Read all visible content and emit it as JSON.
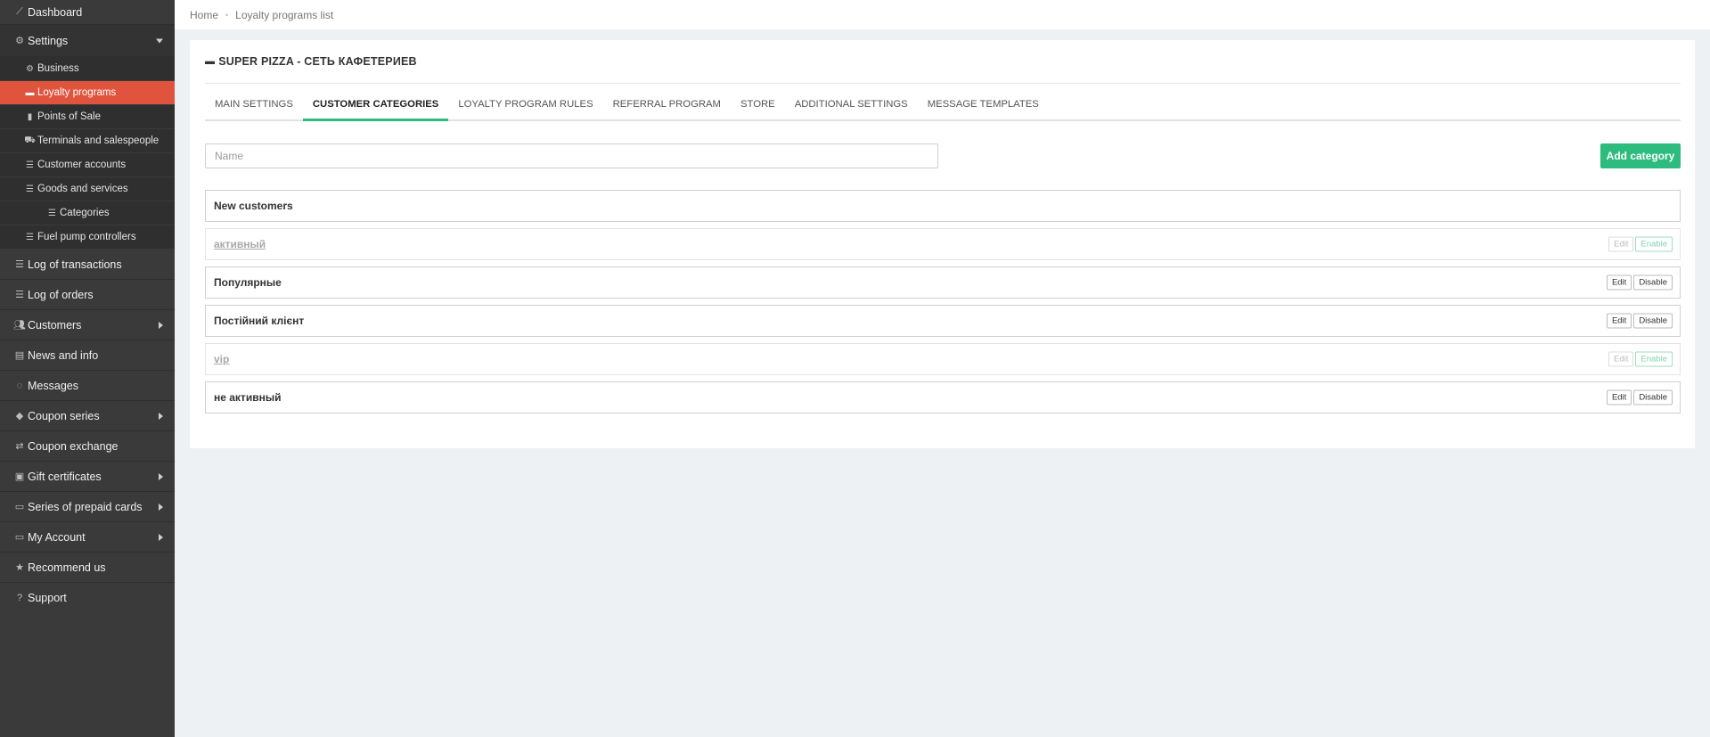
{
  "sidebar": {
    "dashboard": {
      "label": "Dashboard",
      "icon": "chart-line-icon"
    },
    "settings": {
      "label": "Settings",
      "icon": "gear-icon",
      "items": [
        {
          "label": "Business",
          "icon": "gear-icon"
        },
        {
          "label": "Loyalty programs",
          "icon": "briefcase-icon"
        },
        {
          "label": "Points of Sale",
          "icon": "building-icon"
        },
        {
          "label": "Terminals and salespeople",
          "icon": "cart-icon"
        },
        {
          "label": "Customer accounts",
          "icon": "list-icon"
        },
        {
          "label": "Goods and services",
          "icon": "list-icon"
        },
        {
          "label": "Categories",
          "icon": "list-icon"
        },
        {
          "label": "Fuel pump controllers",
          "icon": "list-icon"
        }
      ]
    },
    "items": [
      {
        "label": "Log of transactions",
        "icon": "list-icon"
      },
      {
        "label": "Log of orders",
        "icon": "list-icon"
      },
      {
        "label": "Customers",
        "icon": "users-icon"
      },
      {
        "label": "News and info",
        "icon": "newspaper-icon"
      },
      {
        "label": "Messages",
        "icon": "comment-icon"
      },
      {
        "label": "Coupon series",
        "icon": "tag-icon"
      },
      {
        "label": "Coupon exchange",
        "icon": "exchange-icon"
      },
      {
        "label": "Gift certificates",
        "icon": "gift-icon"
      },
      {
        "label": "Series of prepaid cards",
        "icon": "money-icon"
      },
      {
        "label": "My Account",
        "icon": "credit-card-icon"
      },
      {
        "label": "Recommend us",
        "icon": "star-icon"
      },
      {
        "label": "Support",
        "icon": "question-icon"
      }
    ]
  },
  "breadcrumb": {
    "home": "Home",
    "current": "Loyalty programs list"
  },
  "panel": {
    "title": "SUPER PIZZA - СЕТЬ КАФЕТЕРИЕВ",
    "tabs": [
      "MAIN SETTINGS",
      "CUSTOMER CATEGORIES",
      "LOYALTY PROGRAM RULES",
      "REFERRAL PROGRAM",
      "STORE",
      "ADDITIONAL SETTINGS",
      "MESSAGE TEMPLATES"
    ],
    "name_placeholder": "Name",
    "add_button": "Add category",
    "categories": [
      {
        "name": "New customers"
      },
      {
        "name": "активный",
        "edit": "Edit",
        "toggle": "Enable"
      },
      {
        "name": "Популярные",
        "edit": "Edit",
        "toggle": "Disable"
      },
      {
        "name": "Постійний клієнт",
        "edit": "Edit",
        "toggle": "Disable"
      },
      {
        "name": "vip",
        "edit": "Edit",
        "toggle": "Enable"
      },
      {
        "name": "не активный",
        "edit": "Edit",
        "toggle": "Disable"
      }
    ]
  },
  "colors": {
    "sidebar_bg": "#3a3a3a",
    "active_item": "#e0543e",
    "accent_green": "#2dbb7e",
    "page_bg": "#edf1f4"
  }
}
